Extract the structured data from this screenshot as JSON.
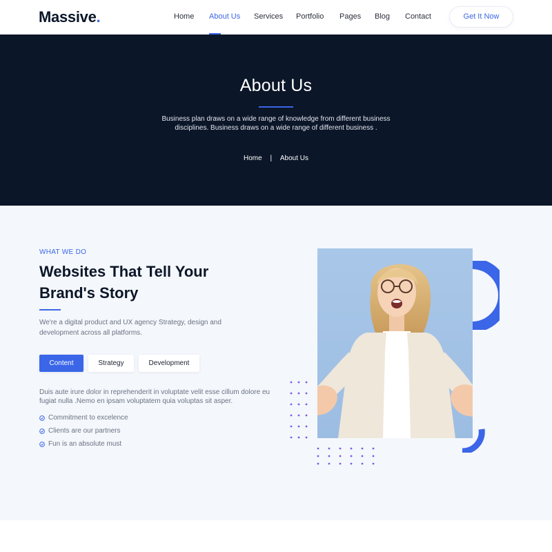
{
  "brand": {
    "name": "Massive",
    "dot": "."
  },
  "nav": {
    "items": [
      {
        "label": "Home",
        "active": false
      },
      {
        "label": "About Us",
        "active": true
      },
      {
        "label": "Services",
        "active": false
      },
      {
        "label": "Portfolio",
        "active": false
      },
      {
        "label": "Pages",
        "active": false
      },
      {
        "label": "Blog",
        "active": false
      },
      {
        "label": "Contact",
        "active": false
      }
    ],
    "cta_label": "Get It Now"
  },
  "hero": {
    "title": "About Us",
    "description": "Business plan draws on a wide range of knowledge from different business disciplines. Business draws on a wide range of different business .",
    "breadcrumb": {
      "home": "Home",
      "separator": "|",
      "current": "About Us"
    }
  },
  "about": {
    "eyebrow": "WHAT WE DO",
    "headline": "Websites That Tell Your Brand's Story",
    "intro": "We're a digital product and UX agency Strategy, design and development across all platforms.",
    "tabs": [
      {
        "label": "Content",
        "active": true
      },
      {
        "label": "Strategy",
        "active": false
      },
      {
        "label": "Development",
        "active": false
      }
    ],
    "body": "Duis aute irure dolor in reprehenderit in voluptate velit esse cillum dolore eu fugiat nulla .Nemo en ipsam voluptatem quia voluptas sit asper.",
    "checklist": [
      "Commitment to excelence",
      "Clients are our partners",
      "Fun is an absolute must"
    ]
  },
  "colors": {
    "accent": "#3b66e8",
    "hero_bg": "#0b1628",
    "section_bg": "#f4f7fb",
    "dots": "#7b5ce0"
  }
}
